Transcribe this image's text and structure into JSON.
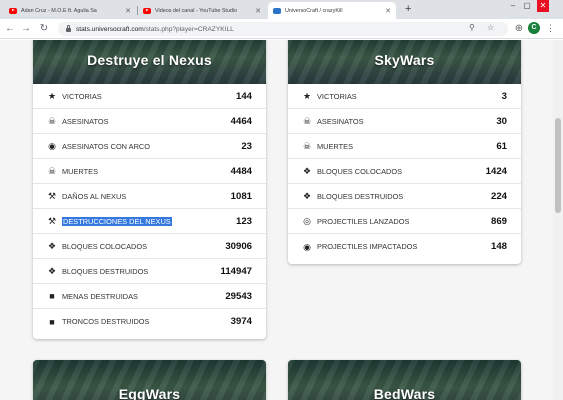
{
  "browser": {
    "tabs": [
      {
        "title": "Adan Cruz - M.O.E ft. Aguila Sa",
        "favicon": "youtube-icon"
      },
      {
        "title": "Videos del canal - YouTube Studio",
        "favicon": "youtube-icon"
      },
      {
        "title": "UniversoCraft / crazyKill",
        "favicon": "universocraft-icon"
      }
    ],
    "new_tab": "+",
    "url_host": "stats.universocraft.com",
    "url_path": "/stats.php?player=CRAZYKILL",
    "avatar_letter": "C"
  },
  "cards": {
    "nexus": {
      "title": "Destruye el Nexus",
      "rows": [
        {
          "icon": "star-icon",
          "label": "VICTORIAS",
          "value": "144"
        },
        {
          "icon": "skull-icon",
          "label": "ASESINATOS",
          "value": "4464"
        },
        {
          "icon": "target-icon",
          "label": "ASESINATOS CON ARCO",
          "value": "23"
        },
        {
          "icon": "crossbones-icon",
          "label": "MUERTES",
          "value": "4484"
        },
        {
          "icon": "hammer-icon",
          "label": "DAÑOS AL NEXUS",
          "value": "1081"
        },
        {
          "icon": "gavel-icon",
          "label": "DESTRUCCIONES DEL NEXUS",
          "value": "123"
        },
        {
          "icon": "cubes-icon",
          "label": "BLOQUES COLOCADOS",
          "value": "30906"
        },
        {
          "icon": "cubes-icon",
          "label": "BLOQUES DESTRUIDOS",
          "value": "114947"
        },
        {
          "icon": "box-icon",
          "label": "MENAS DESTRUIDAS",
          "value": "29543"
        },
        {
          "icon": "box-icon",
          "label": "TRONCOS DESTRUIDOS",
          "value": "3974"
        }
      ]
    },
    "skywars": {
      "title": "SkyWars",
      "rows": [
        {
          "icon": "star-icon",
          "label": "VICTORIAS",
          "value": "3"
        },
        {
          "icon": "skull-icon",
          "label": "ASESINATOS",
          "value": "30"
        },
        {
          "icon": "crossbones-icon",
          "label": "MUERTES",
          "value": "61"
        },
        {
          "icon": "cubes-icon",
          "label": "BLOQUES COLOCADOS",
          "value": "1424"
        },
        {
          "icon": "cubes-icon",
          "label": "BLOQUES DESTRUIDOS",
          "value": "224"
        },
        {
          "icon": "target-icon",
          "label": "PROJECTILES LANZADOS",
          "value": "869"
        },
        {
          "icon": "target-icon",
          "label": "PROJECTILES IMPACTADOS",
          "value": "148"
        }
      ]
    },
    "eggwars": {
      "title": "EggWars"
    },
    "bedwars": {
      "title": "BedWars"
    }
  },
  "colors": {
    "selection": "#3478e0",
    "youtube": "#ff0000",
    "avatar": "#188038"
  }
}
